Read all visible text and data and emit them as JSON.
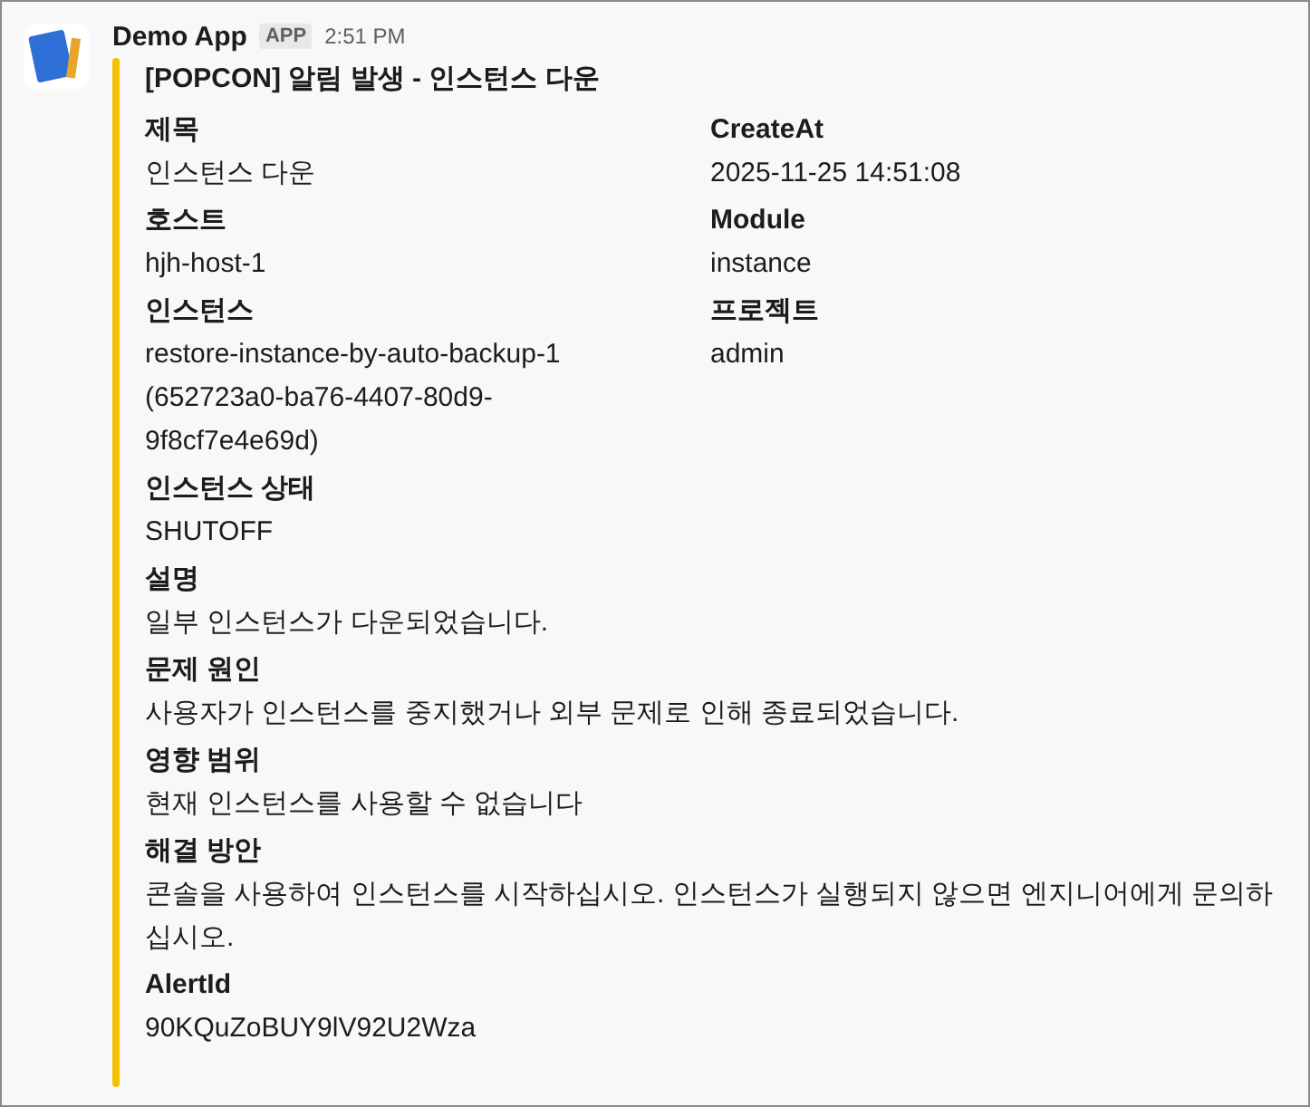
{
  "message": {
    "sender": "Demo App",
    "badge": "APP",
    "time": "2:51 PM"
  },
  "attachment": {
    "title": "[POPCON] 알림 발생 - 인스턴스 다운",
    "fields": [
      {
        "label": "제목",
        "value": "인스턴스 다운",
        "short": true
      },
      {
        "label": "CreateAt",
        "value": "2025-11-25 14:51:08",
        "short": true
      },
      {
        "label": "호스트",
        "value": "hjh-host-1",
        "short": true
      },
      {
        "label": "Module",
        "value": "instance",
        "short": true
      },
      {
        "label": "인스턴스",
        "value": "restore-instance-by-auto-backup-1 (652723a0-ba76-4407-80d9-9f8cf7e4e69d)",
        "short": true
      },
      {
        "label": "프로젝트",
        "value": "admin",
        "short": true
      },
      {
        "label": "인스턴스 상태",
        "value": "SHUTOFF",
        "short": false
      },
      {
        "label": "설명",
        "value": "일부 인스턴스가 다운되었습니다.",
        "short": false
      },
      {
        "label": "문제 원인",
        "value": "사용자가 인스턴스를 중지했거나 외부 문제로 인해 종료되었습니다.",
        "short": false
      },
      {
        "label": "영향 범위",
        "value": "현재 인스턴스를 사용할 수 없습니다",
        "short": false
      },
      {
        "label": "해결 방안",
        "value": "콘솔을 사용하여 인스턴스를 시작하십시오. 인스턴스가 실행되지 않으면 엔지니어에게 문의하십시오.",
        "short": false
      },
      {
        "label": "AlertId",
        "value": "90KQuZoBUY9lV92U2Wza",
        "short": false
      }
    ]
  }
}
